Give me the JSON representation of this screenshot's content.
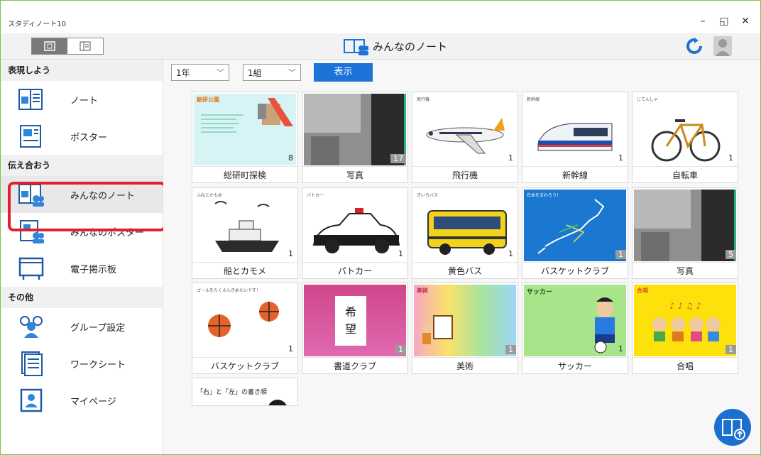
{
  "window": {
    "title": "スタディノート10",
    "min": "–",
    "restore": "◱",
    "close": "✕"
  },
  "header": {
    "title": "みんなのノート"
  },
  "sidebar": {
    "sections": [
      {
        "label": "表現しよう",
        "items": [
          {
            "label": "ノート",
            "icon": "note-icon"
          },
          {
            "label": "ポスター",
            "icon": "poster-icon"
          }
        ]
      },
      {
        "label": "伝え合おう",
        "items": [
          {
            "label": "みんなのノート",
            "icon": "shared-note-icon",
            "selected": true
          },
          {
            "label": "みんなのポスター",
            "icon": "shared-poster-icon"
          },
          {
            "label": "電子掲示板",
            "icon": "bulletin-board-icon"
          }
        ]
      },
      {
        "label": "その他",
        "items": [
          {
            "label": "グループ設定",
            "icon": "group-icon"
          },
          {
            "label": "ワークシート",
            "icon": "worksheet-icon"
          },
          {
            "label": "マイページ",
            "icon": "mypage-icon"
          }
        ]
      }
    ]
  },
  "filters": {
    "grade": "1年",
    "class": "1組",
    "show_button": "表示"
  },
  "cards": [
    {
      "title": "総研町探検",
      "count": "8",
      "mini": "総研公園"
    },
    {
      "title": "写真",
      "count": "17",
      "mini": ""
    },
    {
      "title": "飛行機",
      "count": "1",
      "mini": "飛行機"
    },
    {
      "title": "新幹線",
      "count": "1",
      "mini": "新幹線"
    },
    {
      "title": "自転車",
      "count": "1",
      "mini": "じてんしゃ"
    },
    {
      "title": "船とカモメ",
      "count": "1",
      "mini": "ふねとかもめ"
    },
    {
      "title": "パトカー",
      "count": "1",
      "mini": "パトカー"
    },
    {
      "title": "黄色バス",
      "count": "1",
      "mini": "きいろバス"
    },
    {
      "title": "バスケットクラブ",
      "count": "1",
      "mini": "日本をまわろう！"
    },
    {
      "title": "写真",
      "count": "5",
      "mini": ""
    },
    {
      "title": "バスケットクラブ",
      "count": "1",
      "mini": "ゴールをたくさんきめたいです！"
    },
    {
      "title": "書道クラブ",
      "count": "1",
      "mini": "希望"
    },
    {
      "title": "美術",
      "count": "1",
      "mini": "美術"
    },
    {
      "title": "サッカー",
      "count": "1",
      "mini": "サッカー"
    },
    {
      "title": "合唱",
      "count": "1",
      "mini": "合唱"
    },
    {
      "title": "",
      "count": "",
      "mini": "「右」と「左」の書き順"
    }
  ],
  "colors": {
    "accent": "#1e73d8",
    "selection": "#e0202a",
    "frame": "#7fc24a"
  }
}
